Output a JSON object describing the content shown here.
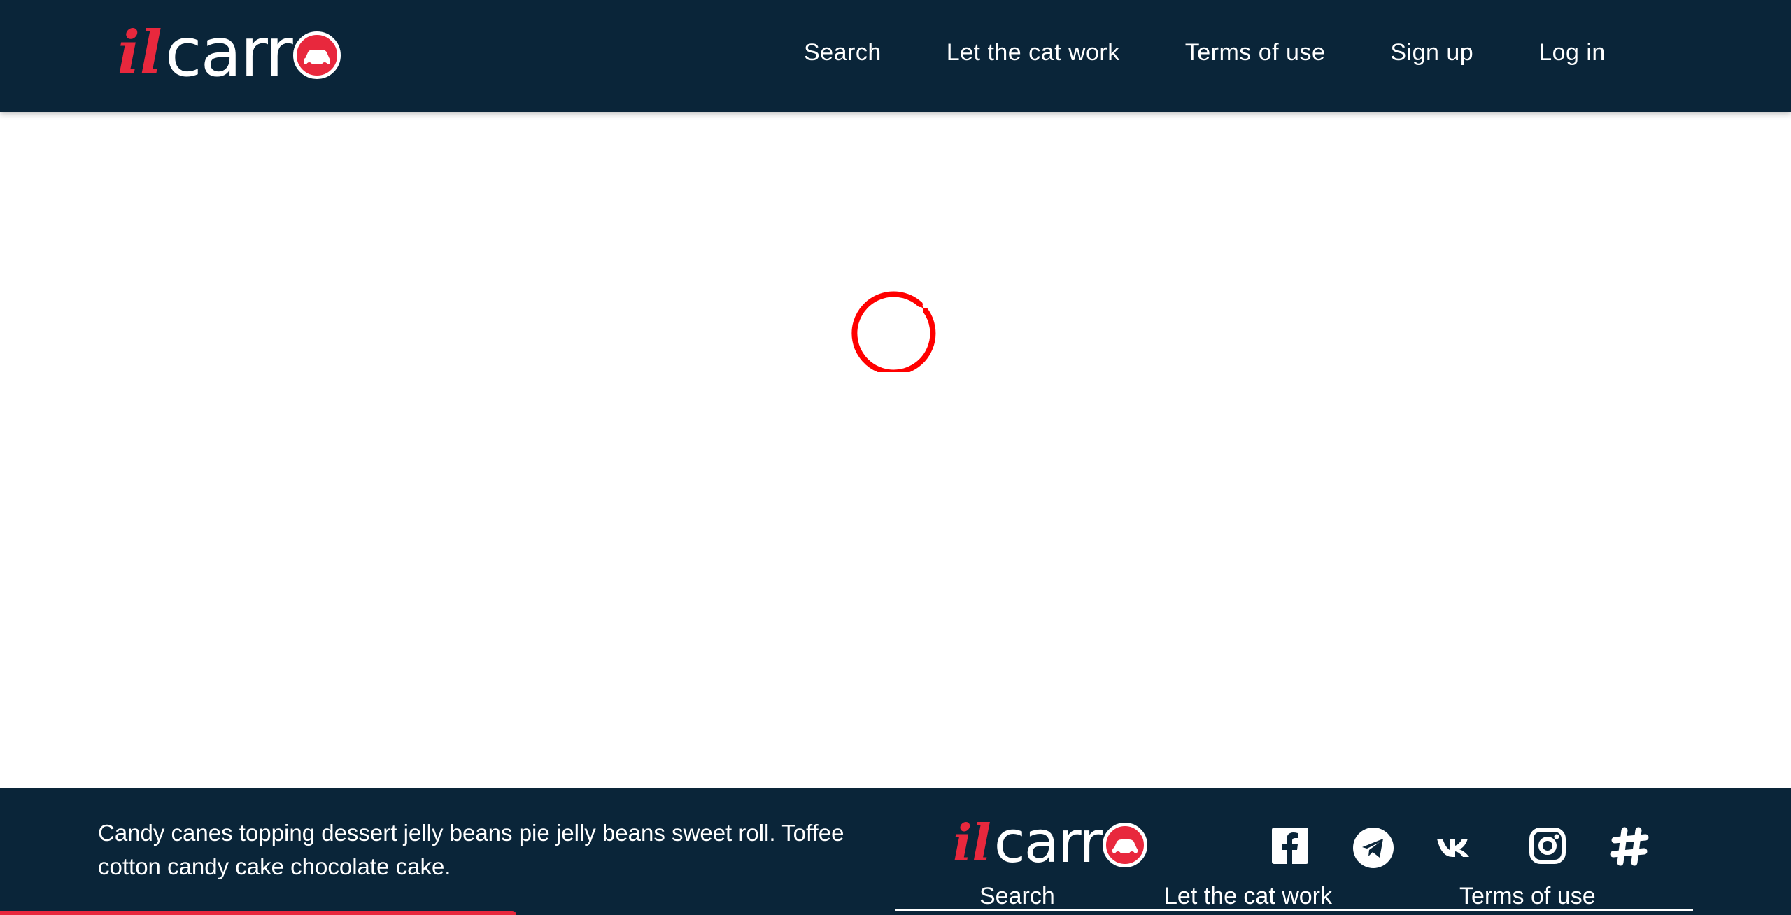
{
  "brand": {
    "logo_prefix": "il",
    "logo_word": "carr",
    "accent_color": "#e8283d",
    "nav_background": "#0a2539"
  },
  "header": {
    "nav": [
      {
        "label": "Search"
      },
      {
        "label": "Let the cat work"
      },
      {
        "label": "Terms of use"
      },
      {
        "label": "Sign up"
      },
      {
        "label": "Log in"
      }
    ]
  },
  "main": {
    "loading_spinner": "loading-spinner-icon"
  },
  "footer": {
    "text": "Candy canes topping dessert jelly beans pie jelly beans sweet roll. Toffee cotton candy cake chocolate cake.",
    "social_icons": [
      "facebook-icon",
      "telegram-icon",
      "vk-icon",
      "instagram-icon",
      "hashtag-icon"
    ],
    "nav": [
      {
        "label": "Search"
      },
      {
        "label": "Let the cat work"
      },
      {
        "label": "Terms of use"
      }
    ]
  }
}
